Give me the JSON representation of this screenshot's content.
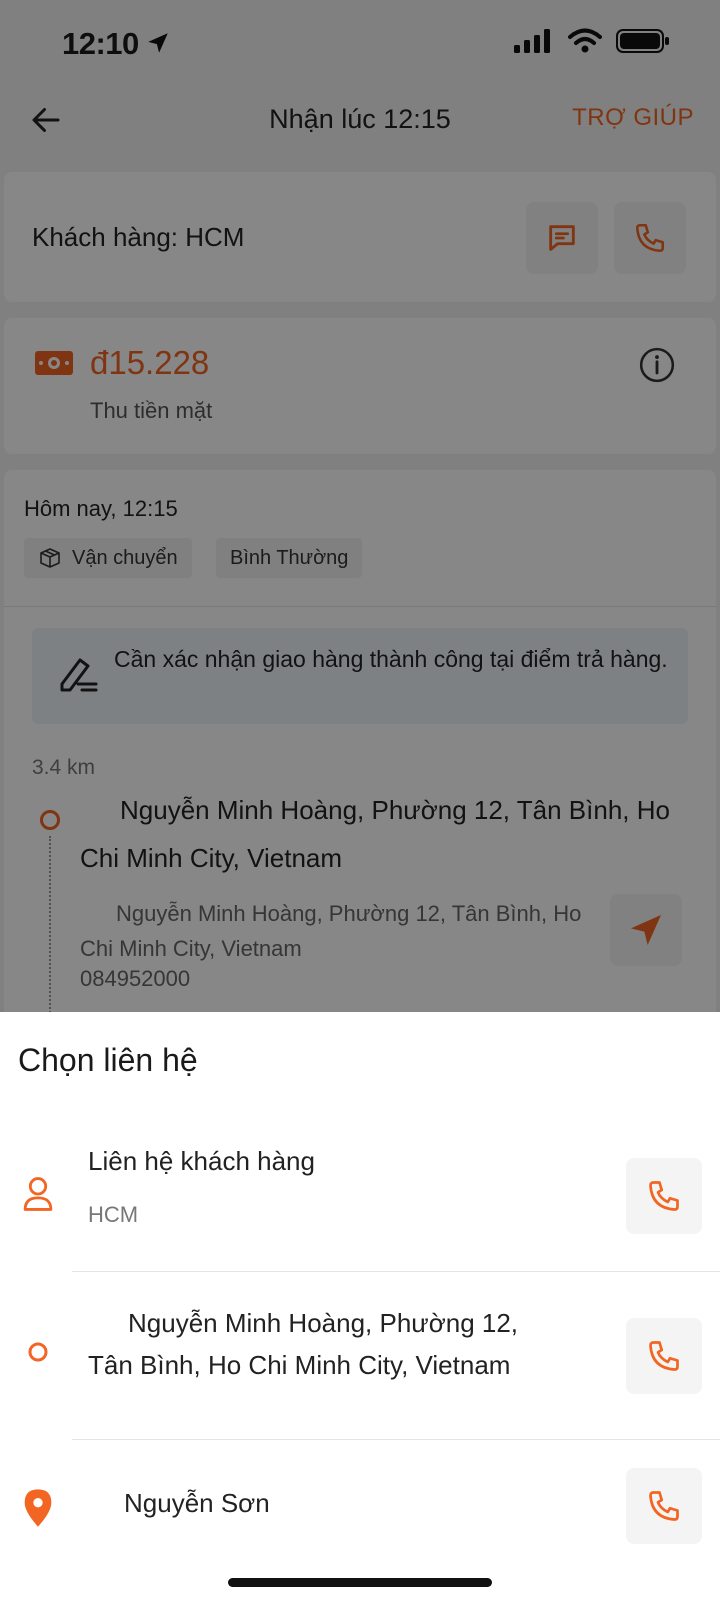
{
  "status_bar": {
    "time": "12:10"
  },
  "top_bar": {
    "title": "Nhận lúc 12:15",
    "help_label": "TRỢ GIÚP"
  },
  "customer": {
    "label": "Khách hàng: HCM"
  },
  "payment": {
    "amount": "đ15.228",
    "method": "Thu tiền mặt"
  },
  "order": {
    "time": "Hôm nay, 12:15",
    "chip_transport": "Vận chuyển",
    "chip_priority": "Bình Thường",
    "notice": "Cần xác nhận giao hàng thành công tại điểm trả hàng.",
    "distance": "3.4 km",
    "dropoff_title": "Nguyễn Minh Hoàng, Phường 12, Tân Bình, Ho Chi Minh City, Vietnam",
    "dropoff_detail": "Nguyễn Minh Hoàng, Phường 12, Tân Bình, Ho Chi Minh City, Vietnam",
    "dropoff_phone": "084952000"
  },
  "sheet": {
    "title": "Chọn liên hệ",
    "contacts": [
      {
        "name": "Liên hệ khách hàng",
        "sub": "HCM",
        "icon": "user-icon"
      },
      {
        "name": "Nguyễn Minh Hoàng, Phường 12, Tân Bình, Ho Chi Minh City, Vietnam",
        "icon": "circle-icon"
      },
      {
        "name": "Nguyễn Sơn",
        "icon": "location-pin-icon"
      }
    ]
  },
  "colors": {
    "accent": "#f26522",
    "overlay": "rgba(0,0,0,0.47)"
  }
}
